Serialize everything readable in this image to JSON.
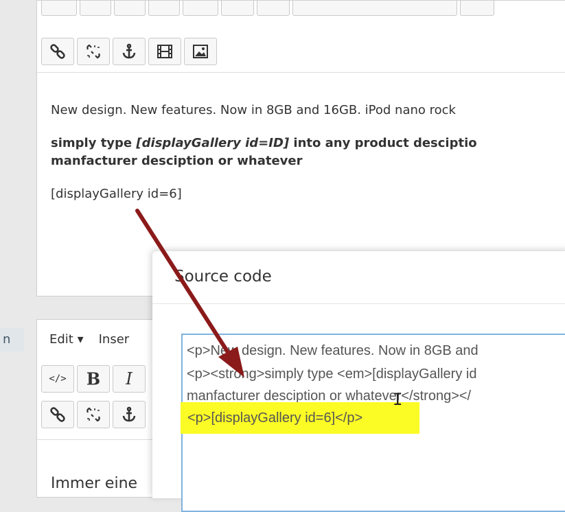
{
  "top_editor": {
    "paragraph_1": "New design. New features. Now in 8GB and 16GB. iPod nano rock",
    "strong_before": "simply type ",
    "strong_em": "[displayGallery id=ID]",
    "strong_after": " into any product desciptio",
    "strong_line2": "manfacturer desciption or whatever",
    "paragraph_3": "[displayGallery id=6]"
  },
  "left_stub": {
    "label": "n"
  },
  "bottom_editor": {
    "menu_edit": "Edit ▾",
    "menu_insert": "Inser",
    "bold_label": "B",
    "italic_label": "I",
    "code_label": "</>",
    "content_text": "Immer eine"
  },
  "modal": {
    "title": "Source code",
    "code_lines": [
      "<p>New design. New features. Now in 8GB and",
      "<p><strong>simply type <em>[displayGallery id",
      "manfacturer desciption or whatever</strong></",
      "<p>[displayGallery id=6]</p>"
    ]
  },
  "colors": {
    "highlight": "#fbfb25",
    "arrow": "#8b1a1a",
    "focus_border": "#7fb3df"
  }
}
